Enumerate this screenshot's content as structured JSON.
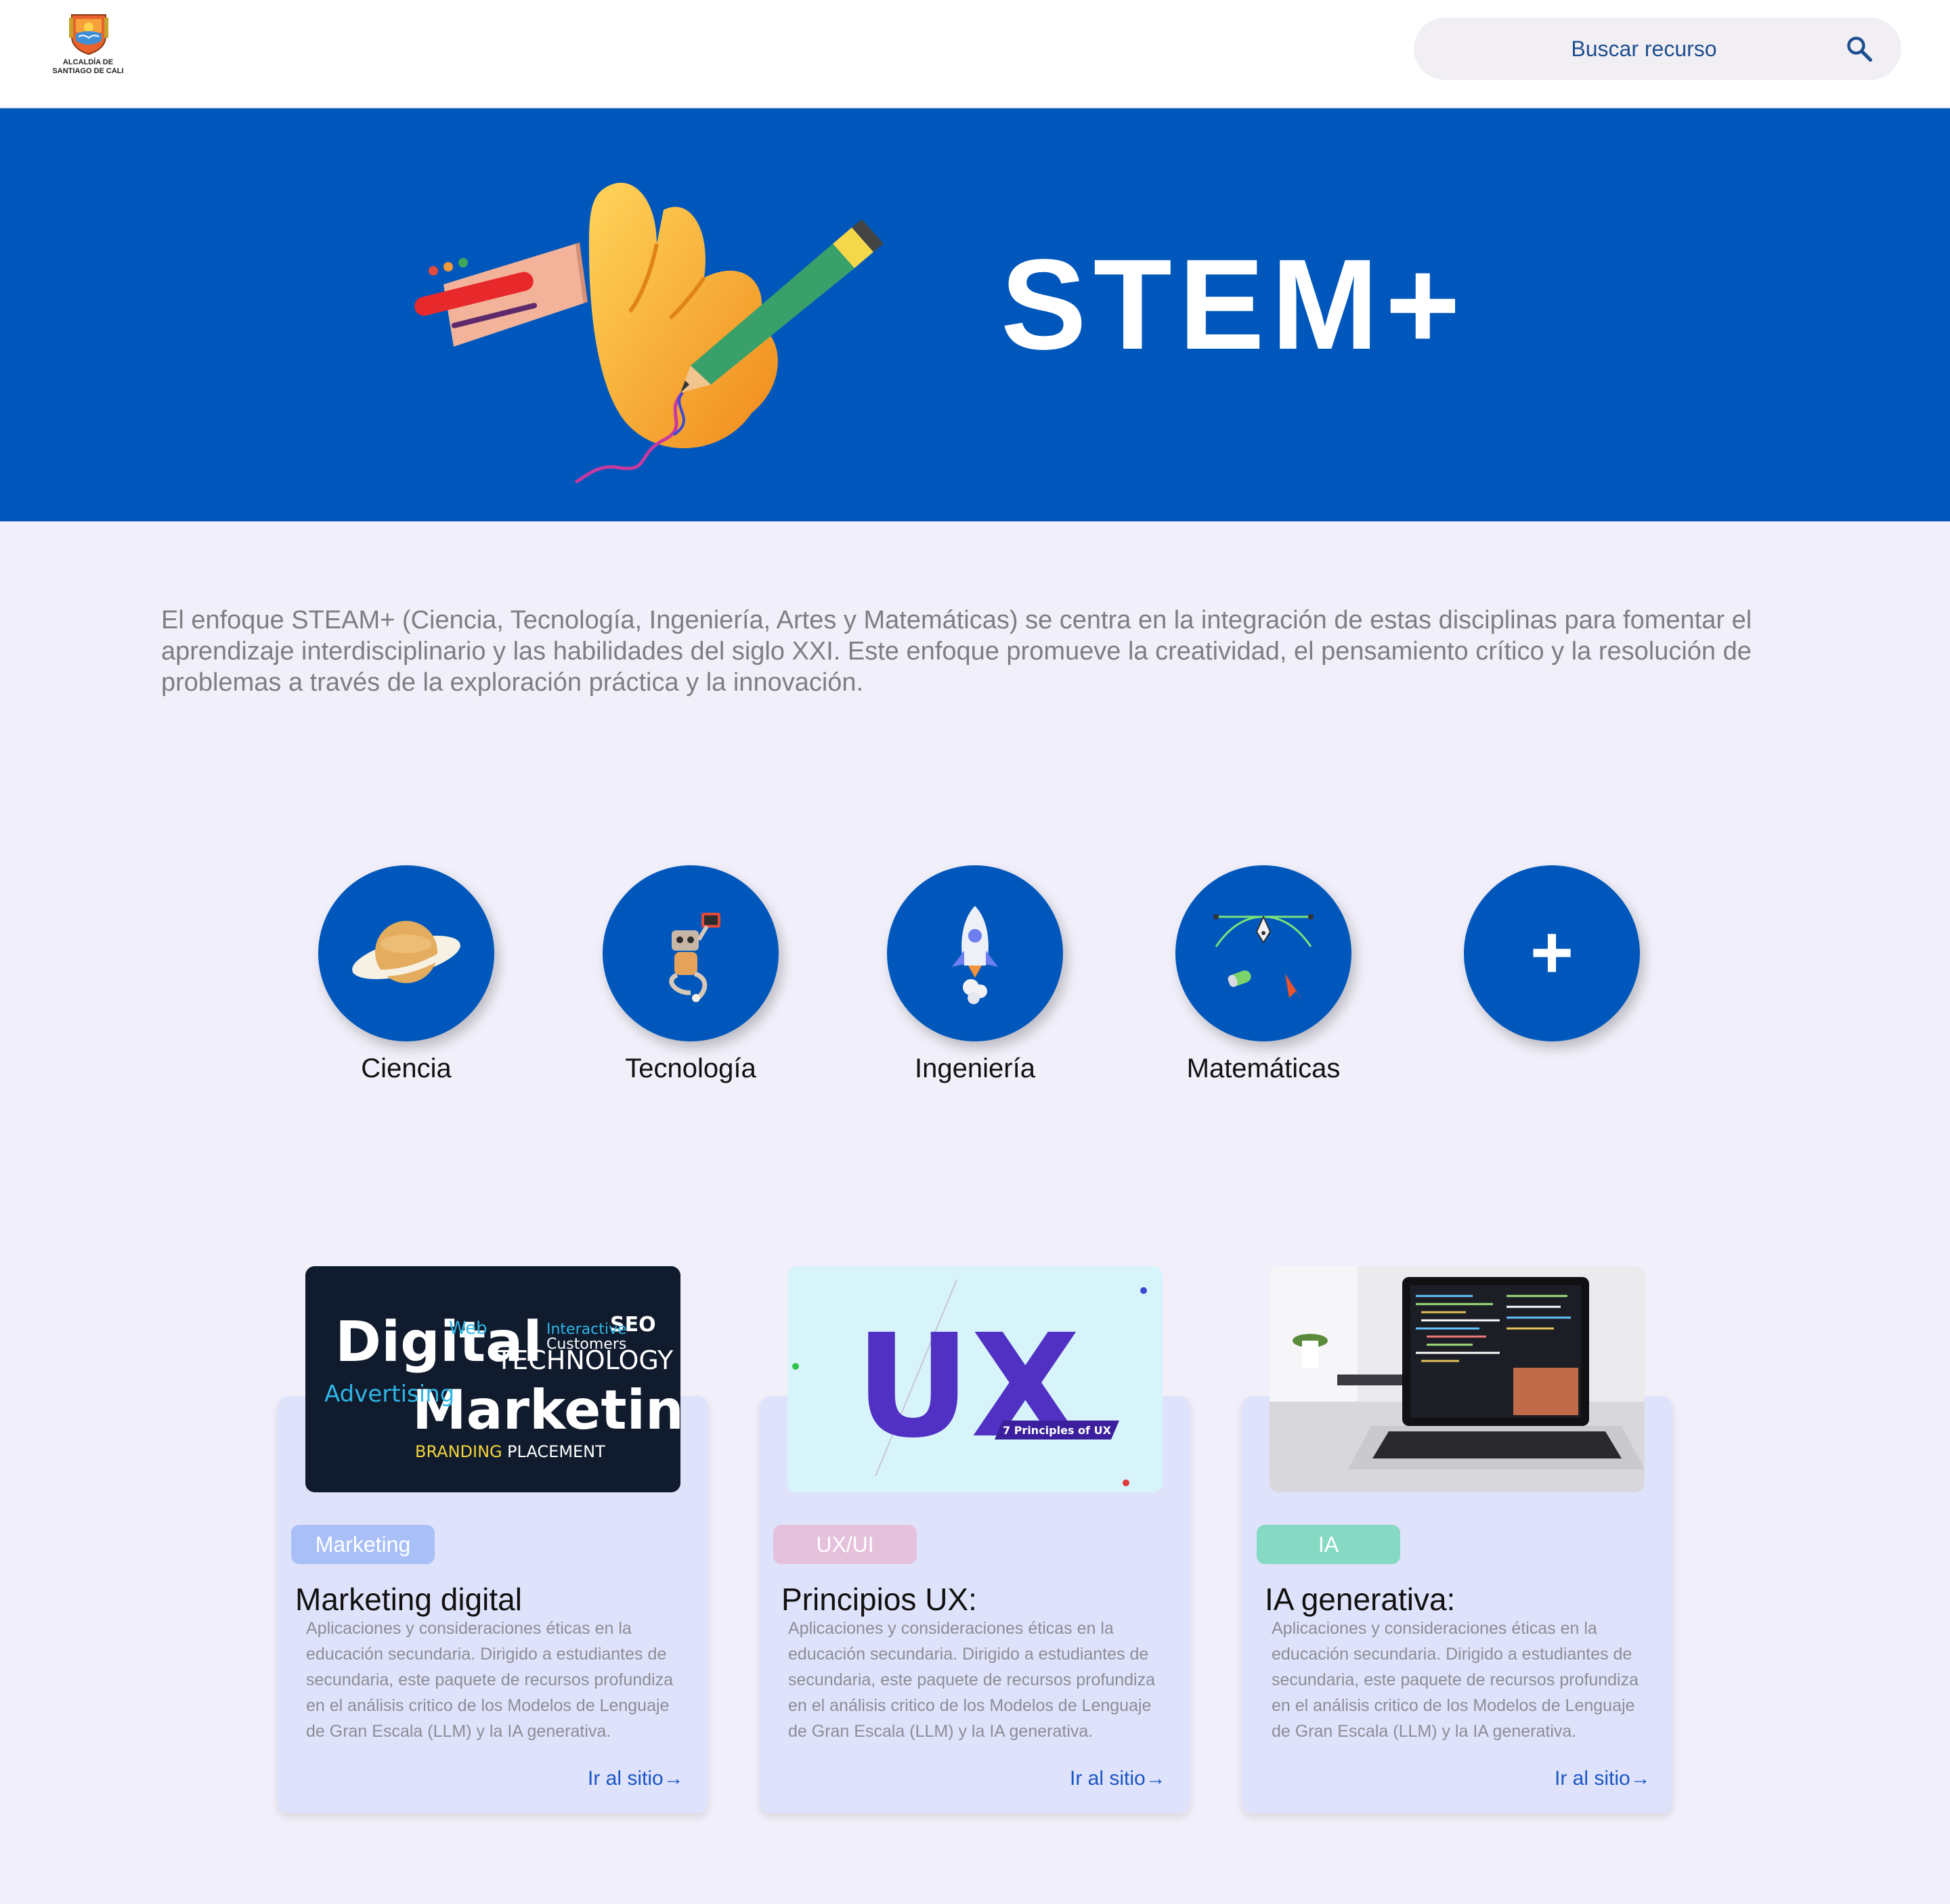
{
  "header": {
    "logo": {
      "line1": "ALCALDÍA DE",
      "line2": "SANTIAGO DE CALI"
    },
    "search": {
      "placeholder": "Buscar recurso",
      "icon": "search-icon"
    }
  },
  "hero": {
    "title": "STEM+"
  },
  "intro": {
    "text": "El enfoque STEAM+ (Ciencia, Tecnología, Ingeniería, Artes y Matemáticas) se centra en la integración de estas disciplinas para fomentar el aprendizaje interdisciplinario y las habilidades del siglo XXI. Este enfoque promueve la creatividad, el pensamiento crítico y la resolución de problemas a través de la exploración práctica y la innovación."
  },
  "categories": [
    {
      "label": "Ciencia",
      "icon": "planet-icon"
    },
    {
      "label": "Tecnología",
      "icon": "robot-icon"
    },
    {
      "label": "Ingeniería",
      "icon": "rocket-icon"
    },
    {
      "label": "Matemáticas",
      "icon": "pen-tool-icon"
    },
    {
      "label": "+",
      "icon": "plus-icon"
    }
  ],
  "cards": [
    {
      "tag": "Marketing",
      "tag_color": "#a9bff8",
      "title": "Marketing digital",
      "description": "Aplicaciones y consideraciones éticas en la educación secundaria. Dirigido a estudiantes de secundaria, este paquete de recursos profundiza en el análisis critico de los Modelos de Lenguaje de Gran Escala (LLM) y la IA generativa.",
      "link": "Ir al sitio→",
      "image_words": {
        "line1": "Digital",
        "line2": "Marketing",
        "tech": "TECHNOLOGY",
        "advertising": "Advertising",
        "branding": "BRANDING",
        "placement": "PLACEMENT",
        "seo": "SEO",
        "web": "Web",
        "interactive": "Interactive",
        "customers": "Customers"
      }
    },
    {
      "tag": "UX/UI",
      "tag_color": "#e5c1dc",
      "title": "Principios UX:",
      "description": "Aplicaciones y consideraciones éticas en la educación secundaria. Dirigido a estudiantes de secundaria, este paquete de recursos profundiza en el análisis critico de los Modelos de Lenguaje de Gran Escala (LLM) y la IA generativa.",
      "link": "Ir al sitio→",
      "image_words": {
        "big": "UX",
        "ribbon": "7 Principles of UX"
      }
    },
    {
      "tag": "IA",
      "tag_color": "#86d9c3",
      "title": "IA generativa:",
      "description": "Aplicaciones y consideraciones éticas en la educación secundaria. Dirigido a estudiantes de secundaria, este paquete de recursos profundiza en el análisis critico de los Modelos de Lenguaje de Gran Escala (LLM) y la IA generativa.",
      "link": "Ir al sitio→"
    }
  ],
  "colors": {
    "brand_blue": "#0057bb",
    "page_bg": "#f1eff9",
    "card_bg": "#dfe2fb",
    "link": "#1a56c4"
  }
}
